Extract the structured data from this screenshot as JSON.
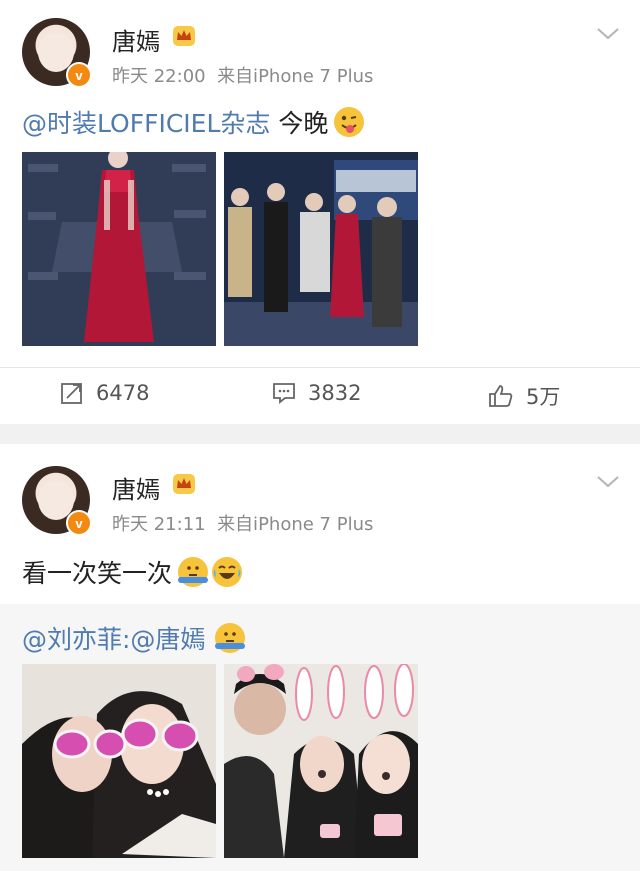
{
  "posts": [
    {
      "author": "唐嫣",
      "time": "昨天 22:00",
      "source": "来自iPhone 7 Plus",
      "text_mention": "@时装LOFFICIEL杂志",
      "text_rest": " 今晚",
      "stats": {
        "repost": "6478",
        "comment": "3832",
        "like": "5万"
      }
    },
    {
      "author": "唐嫣",
      "time": "昨天 21:11",
      "source": "来自iPhone 7 Plus",
      "text": "看一次笑一次",
      "repost_mention": "@刘亦菲:@唐嫣"
    }
  ],
  "colors": {
    "mention": "#4f7bb0",
    "badge": "#f28a12",
    "crown": "#f0a01e"
  },
  "icons": [
    "crown-icon",
    "v-badge-icon",
    "chevron-down-icon",
    "repost-icon",
    "comment-icon",
    "like-icon",
    "emoji"
  ]
}
